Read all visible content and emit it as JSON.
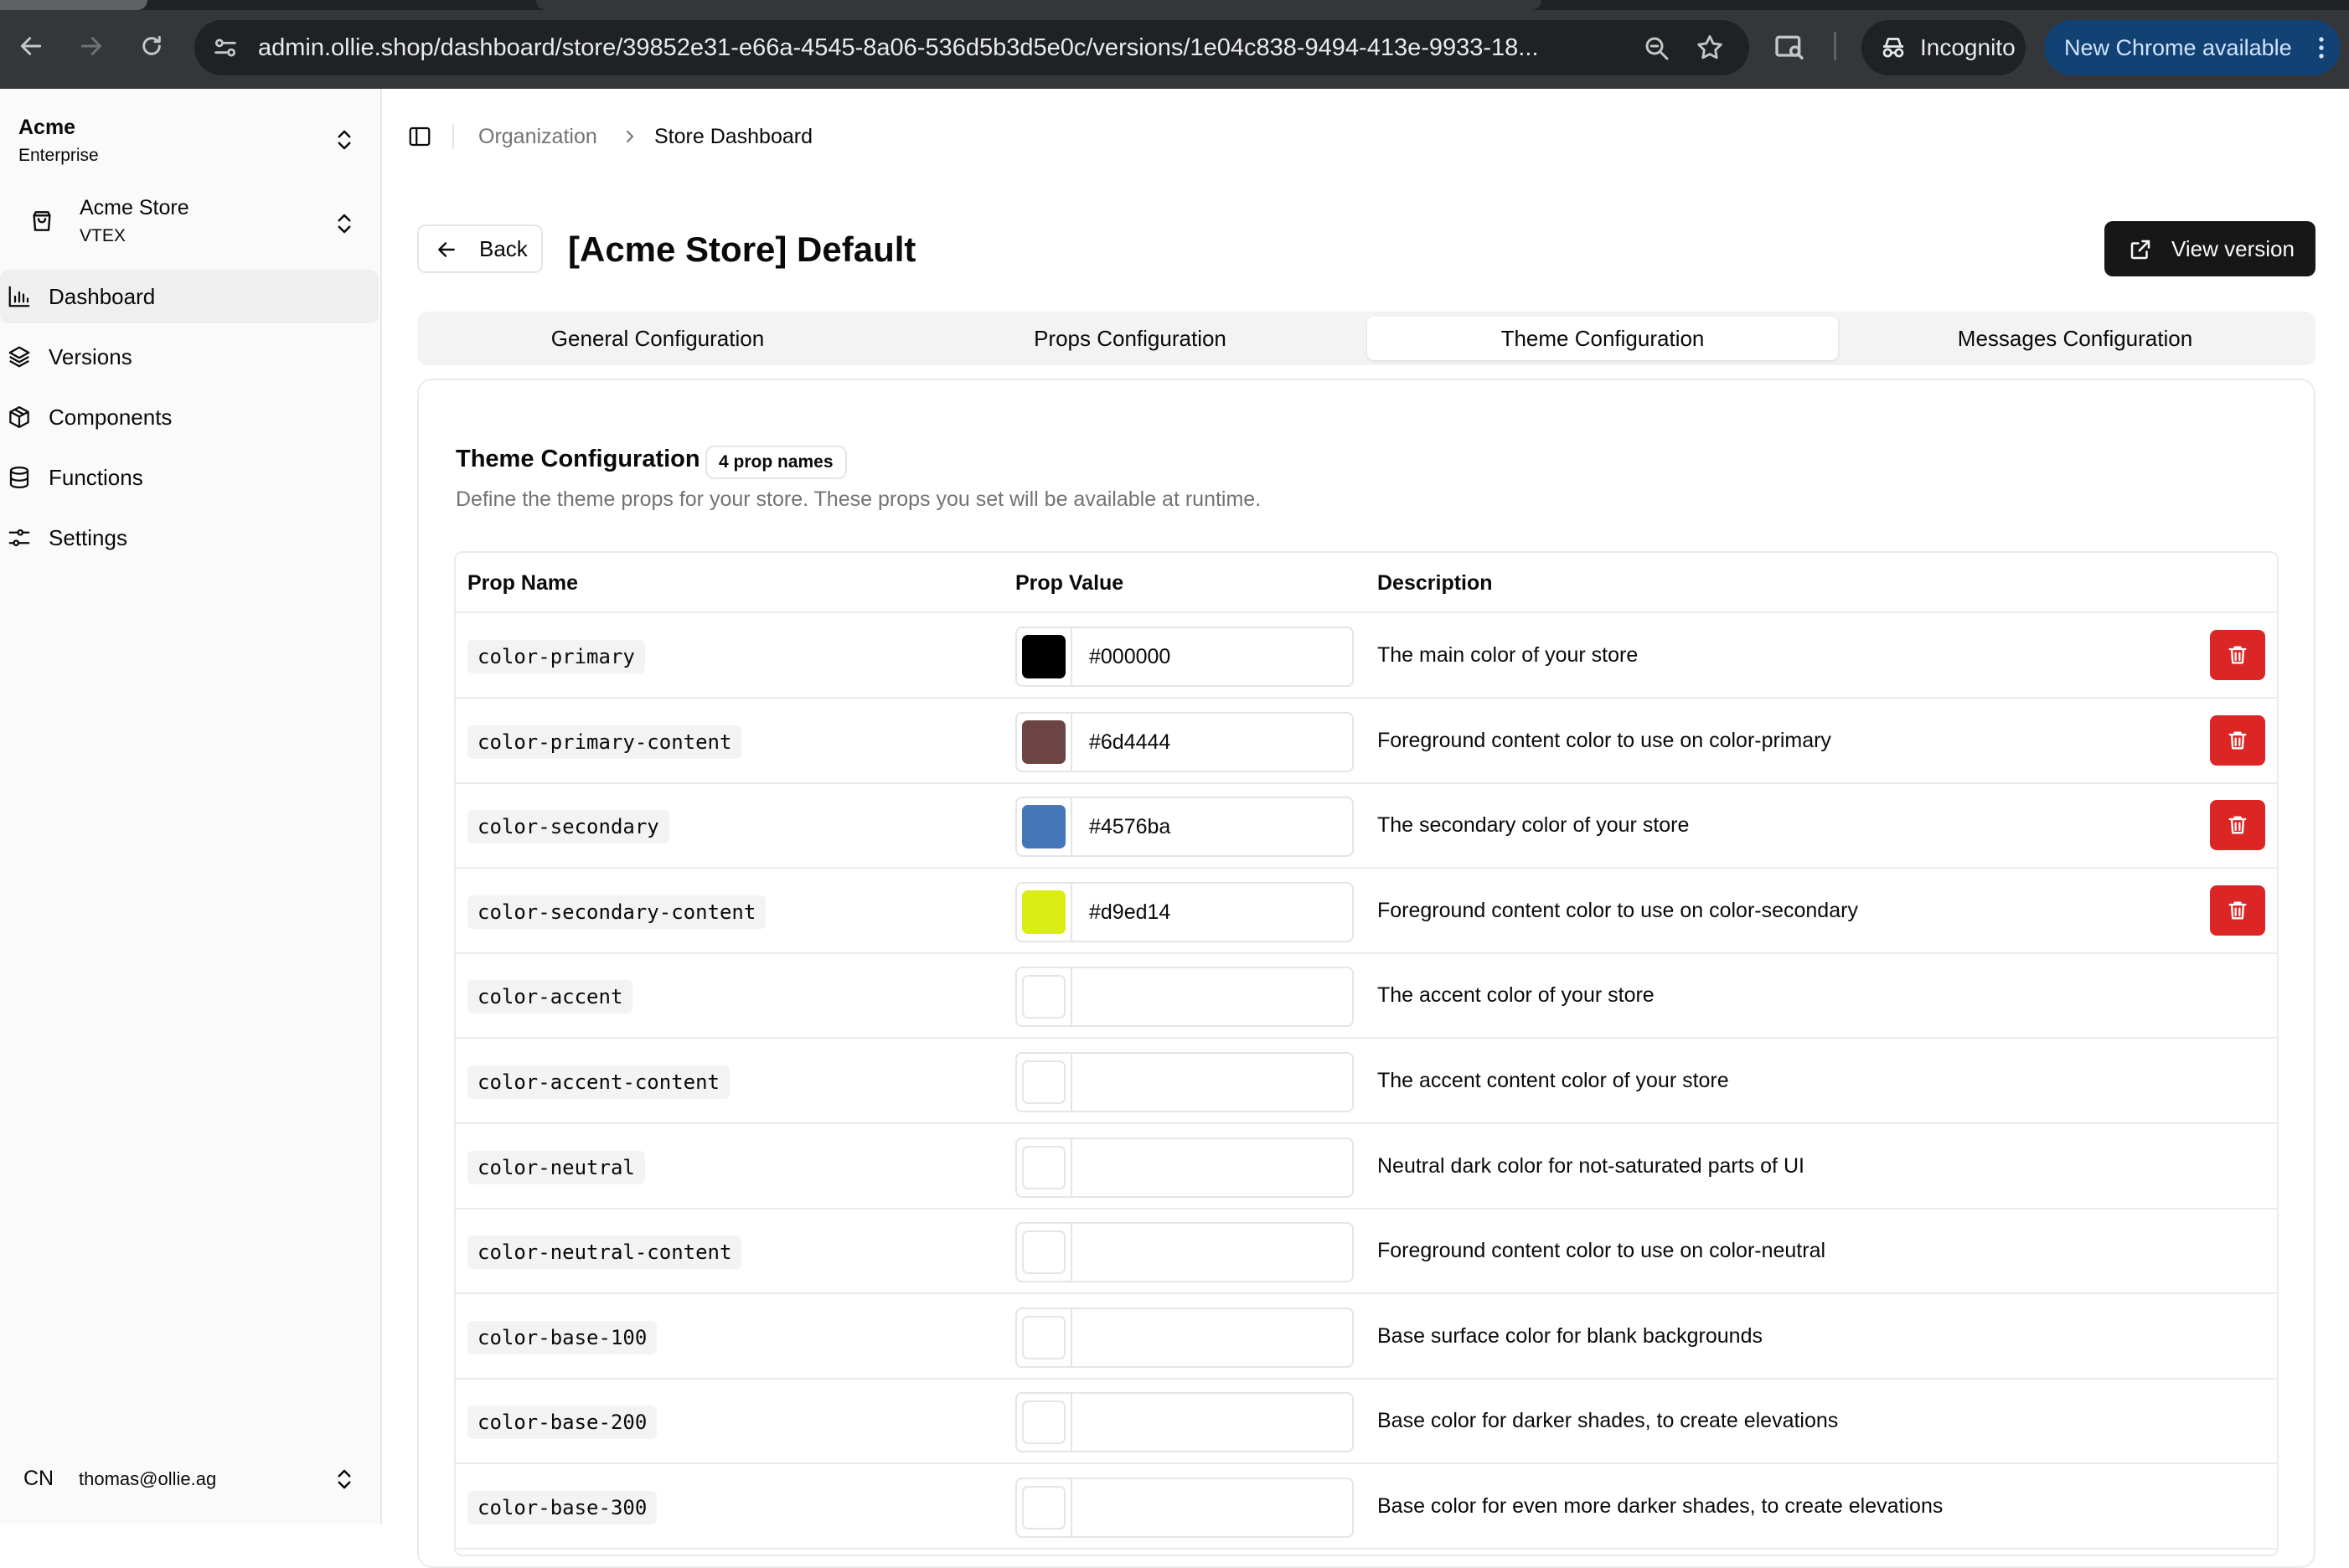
{
  "browser": {
    "url": "admin.ollie.shop/dashboard/store/39852e31-e66a-4545-8a06-536d5b3d5e0c/versions/1e04c838-9494-413e-9933-18...",
    "incognito_label": "Incognito",
    "update_label": "New Chrome available"
  },
  "sidebar": {
    "org": {
      "name": "Acme",
      "plan": "Enterprise"
    },
    "store": {
      "name": "Acme Store",
      "platform": "VTEX"
    },
    "items": [
      {
        "label": "Dashboard",
        "icon": "bar-chart-icon",
        "active": true
      },
      {
        "label": "Versions",
        "icon": "layers-icon",
        "active": false
      },
      {
        "label": "Components",
        "icon": "package-icon",
        "active": false
      },
      {
        "label": "Functions",
        "icon": "database-icon",
        "active": false
      },
      {
        "label": "Settings",
        "icon": "sliders-icon",
        "active": false
      }
    ],
    "user": {
      "initials": "CN",
      "email": "thomas@ollie.ag"
    }
  },
  "breadcrumb": {
    "items": [
      "Organization",
      "Store Dashboard"
    ]
  },
  "header": {
    "back_label": "Back",
    "title": "[Acme Store] Default",
    "view_version_label": "View version"
  },
  "tabs": [
    {
      "label": "General Configuration",
      "active": false
    },
    {
      "label": "Props Configuration",
      "active": false
    },
    {
      "label": "Theme Configuration",
      "active": true
    },
    {
      "label": "Messages Configuration",
      "active": false
    }
  ],
  "card": {
    "title": "Theme Configuration",
    "badge": "4 prop names",
    "description": "Define the theme props for your store. These props you set will be available at runtime."
  },
  "table": {
    "columns": [
      "Prop Name",
      "Prop Value",
      "Description"
    ],
    "rows": [
      {
        "name": "color-primary",
        "value": "#000000",
        "color": "#000000",
        "description": "The main color of your store",
        "deletable": true
      },
      {
        "name": "color-primary-content",
        "value": "#6d4444",
        "color": "#6d4444",
        "description": "Foreground content color to use on color-primary",
        "deletable": true
      },
      {
        "name": "color-secondary",
        "value": "#4576ba",
        "color": "#4576ba",
        "description": "The secondary color of your store",
        "deletable": true
      },
      {
        "name": "color-secondary-content",
        "value": "#d9ed14",
        "color": "#d9ed14",
        "description": "Foreground content color to use on color-secondary",
        "deletable": true
      },
      {
        "name": "color-accent",
        "value": "",
        "color": "",
        "description": "The accent color of your store",
        "deletable": false
      },
      {
        "name": "color-accent-content",
        "value": "",
        "color": "",
        "description": "The accent content color of your store",
        "deletable": false
      },
      {
        "name": "color-neutral",
        "value": "",
        "color": "",
        "description": "Neutral dark color for not-saturated parts of UI",
        "deletable": false
      },
      {
        "name": "color-neutral-content",
        "value": "",
        "color": "",
        "description": "Foreground content color to use on color-neutral",
        "deletable": false
      },
      {
        "name": "color-base-100",
        "value": "",
        "color": "",
        "description": "Base surface color for blank backgrounds",
        "deletable": false
      },
      {
        "name": "color-base-200",
        "value": "",
        "color": "",
        "description": "Base color for darker shades, to create elevations",
        "deletable": false
      },
      {
        "name": "color-base-300",
        "value": "",
        "color": "",
        "description": "Base color for even more darker shades, to create elevations",
        "deletable": false
      }
    ]
  },
  "colors": {
    "delete": "#dc2626",
    "primary_button": "#171717",
    "chrome_update": "#124273"
  }
}
